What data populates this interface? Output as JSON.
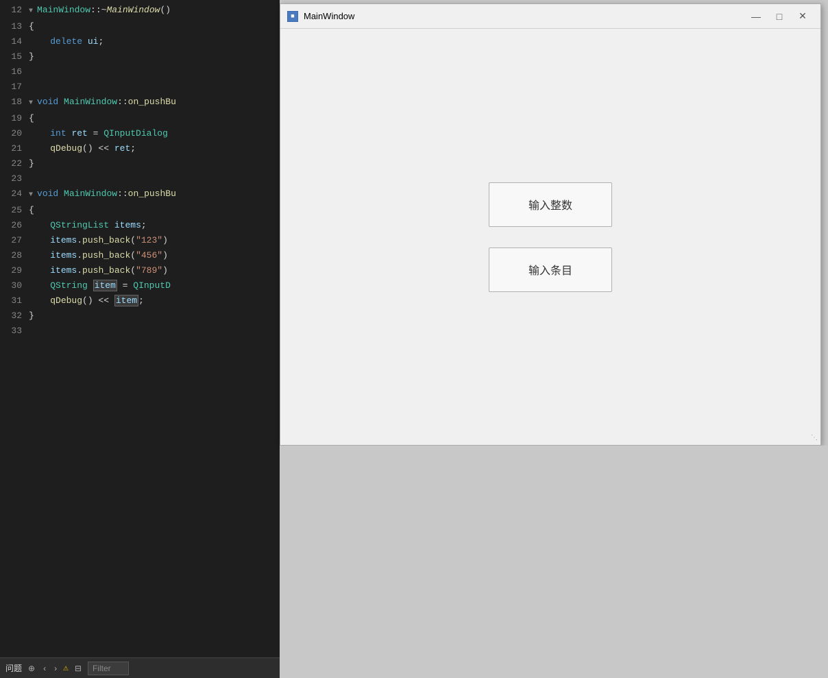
{
  "editor": {
    "background": "#1e1e1e",
    "lines": [
      {
        "num": "12",
        "tokens": [
          {
            "type": "collapse",
            "text": "▼ "
          },
          {
            "type": "cls",
            "text": "MainWindow"
          },
          {
            "type": "op",
            "text": "::~"
          },
          {
            "type": "destructor",
            "text": "MainWindow"
          },
          {
            "type": "op",
            "text": "()"
          }
        ]
      },
      {
        "num": "13",
        "tokens": [
          {
            "type": "plain",
            "text": "{"
          }
        ]
      },
      {
        "num": "14",
        "tokens": [
          {
            "type": "plain",
            "text": "    "
          },
          {
            "type": "kw",
            "text": "delete"
          },
          {
            "type": "plain",
            "text": " "
          },
          {
            "type": "var",
            "text": "ui"
          },
          {
            "type": "plain",
            "text": ";"
          }
        ]
      },
      {
        "num": "15",
        "tokens": [
          {
            "type": "plain",
            "text": "}"
          }
        ]
      },
      {
        "num": "16",
        "tokens": []
      },
      {
        "num": "17",
        "tokens": []
      },
      {
        "num": "18",
        "tokens": [
          {
            "type": "collapse",
            "text": "▼ "
          },
          {
            "type": "kw",
            "text": "void"
          },
          {
            "type": "plain",
            "text": " "
          },
          {
            "type": "cls",
            "text": "MainWindow"
          },
          {
            "type": "plain",
            "text": "::"
          },
          {
            "type": "fn",
            "text": "on_pushBu"
          }
        ]
      },
      {
        "num": "19",
        "tokens": [
          {
            "type": "plain",
            "text": "{"
          }
        ]
      },
      {
        "num": "20",
        "tokens": [
          {
            "type": "plain",
            "text": "    "
          },
          {
            "type": "kw",
            "text": "int"
          },
          {
            "type": "plain",
            "text": " "
          },
          {
            "type": "var",
            "text": "ret"
          },
          {
            "type": "plain",
            "text": " = "
          },
          {
            "type": "cls",
            "text": "QInputDialog"
          }
        ]
      },
      {
        "num": "21",
        "tokens": [
          {
            "type": "plain",
            "text": "    "
          },
          {
            "type": "method",
            "text": "qDebug"
          },
          {
            "type": "plain",
            "text": "() << "
          },
          {
            "type": "var",
            "text": "ret"
          },
          {
            "type": "plain",
            "text": ";"
          }
        ]
      },
      {
        "num": "22",
        "tokens": [
          {
            "type": "plain",
            "text": "}"
          }
        ]
      },
      {
        "num": "23",
        "tokens": []
      },
      {
        "num": "24",
        "tokens": [
          {
            "type": "collapse",
            "text": "▼ "
          },
          {
            "type": "kw",
            "text": "void"
          },
          {
            "type": "plain",
            "text": " "
          },
          {
            "type": "cls",
            "text": "MainWindow"
          },
          {
            "type": "plain",
            "text": "::"
          },
          {
            "type": "fn",
            "text": "on_pushBu"
          }
        ]
      },
      {
        "num": "25",
        "tokens": [
          {
            "type": "plain",
            "text": "{"
          }
        ]
      },
      {
        "num": "26",
        "tokens": [
          {
            "type": "plain",
            "text": "    "
          },
          {
            "type": "cls",
            "text": "QStringList"
          },
          {
            "type": "plain",
            "text": " "
          },
          {
            "type": "var",
            "text": "items"
          },
          {
            "type": "plain",
            "text": ";"
          }
        ]
      },
      {
        "num": "27",
        "tokens": [
          {
            "type": "plain",
            "text": "    "
          },
          {
            "type": "var",
            "text": "items"
          },
          {
            "type": "plain",
            "text": "."
          },
          {
            "type": "method",
            "text": "push_back"
          },
          {
            "type": "plain",
            "text": "("
          },
          {
            "type": "str",
            "text": "\"123\""
          },
          {
            "type": "plain",
            "text": ")"
          }
        ]
      },
      {
        "num": "28",
        "tokens": [
          {
            "type": "plain",
            "text": "    "
          },
          {
            "type": "var",
            "text": "items"
          },
          {
            "type": "plain",
            "text": "."
          },
          {
            "type": "method",
            "text": "push_back"
          },
          {
            "type": "plain",
            "text": "("
          },
          {
            "type": "str",
            "text": "\"456\""
          },
          {
            "type": "plain",
            "text": ")"
          }
        ]
      },
      {
        "num": "29",
        "tokens": [
          {
            "type": "plain",
            "text": "    "
          },
          {
            "type": "var",
            "text": "items"
          },
          {
            "type": "plain",
            "text": "."
          },
          {
            "type": "method",
            "text": "push_back"
          },
          {
            "type": "plain",
            "text": "("
          },
          {
            "type": "str",
            "text": "\"789\""
          },
          {
            "type": "plain",
            "text": ")"
          }
        ]
      },
      {
        "num": "30",
        "tokens": [
          {
            "type": "plain",
            "text": "    "
          },
          {
            "type": "cls",
            "text": "QString"
          },
          {
            "type": "plain",
            "text": " "
          },
          {
            "type": "highlight",
            "text": "item"
          },
          {
            "type": "plain",
            "text": " = "
          },
          {
            "type": "cls",
            "text": "QInputD"
          }
        ]
      },
      {
        "num": "31",
        "tokens": [
          {
            "type": "plain",
            "text": "    "
          },
          {
            "type": "method",
            "text": "qDebug"
          },
          {
            "type": "plain",
            "text": "() << "
          },
          {
            "type": "highlight",
            "text": "item"
          },
          {
            "type": "plain",
            "text": ";"
          }
        ]
      },
      {
        "num": "32",
        "tokens": [
          {
            "type": "plain",
            "text": "}"
          }
        ]
      },
      {
        "num": "33",
        "tokens": []
      }
    ]
  },
  "statusbar": {
    "label": "问题",
    "filter_placeholder": "Filter"
  },
  "qt_window": {
    "title": "MainWindow",
    "icon_text": "■",
    "btn_minimize": "—",
    "btn_maximize": "□",
    "btn_close": "✕",
    "button1_label": "输入整数",
    "button2_label": "输入条目"
  }
}
